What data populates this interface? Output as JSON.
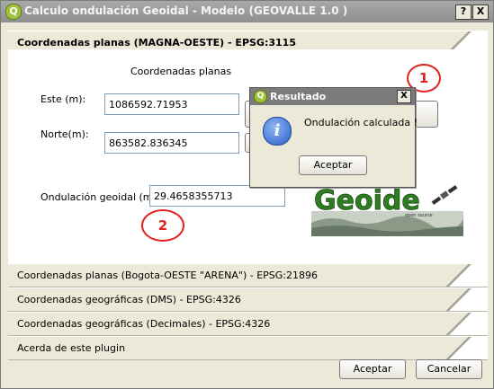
{
  "window": {
    "title": "Calculo ondulación Geoidal - Modelo (GEOVALLE 1.0 )",
    "help_label": "?",
    "close_label": "X"
  },
  "panels": {
    "active_header": "Coordenadas planas (MAGNA-OESTE) - EPSG:3115",
    "section_title": "Coordenadas planas",
    "este_label": "Este (m):",
    "este_value": "1086592.71953",
    "norte_label": "Norte(m):",
    "norte_value": "863582.836345",
    "ondulacion_label": "Ondulación geoidal (m):",
    "ondulacion_value": "29.4658355713",
    "collapsed": [
      "Coordenadas planas (Bogota-OESTE \"ARENA\") - EPSG:21896",
      "Coordenadas geográficas (DMS) - EPSG:4326",
      "Coordenadas geográficas (Decimales)  - EPSG:4326",
      "Acerda de este plugin"
    ]
  },
  "logo": {
    "text": "Geoide",
    "subtext": "open source"
  },
  "annotations": {
    "one": "1",
    "two": "2",
    "color": "#e0231c"
  },
  "dialog": {
    "title": "Resultado",
    "message": "Ondulación calculada !",
    "accept_label": "Aceptar",
    "close_label": "X"
  },
  "footer": {
    "accept_label": "Aceptar",
    "cancel_label": "Cancelar"
  }
}
